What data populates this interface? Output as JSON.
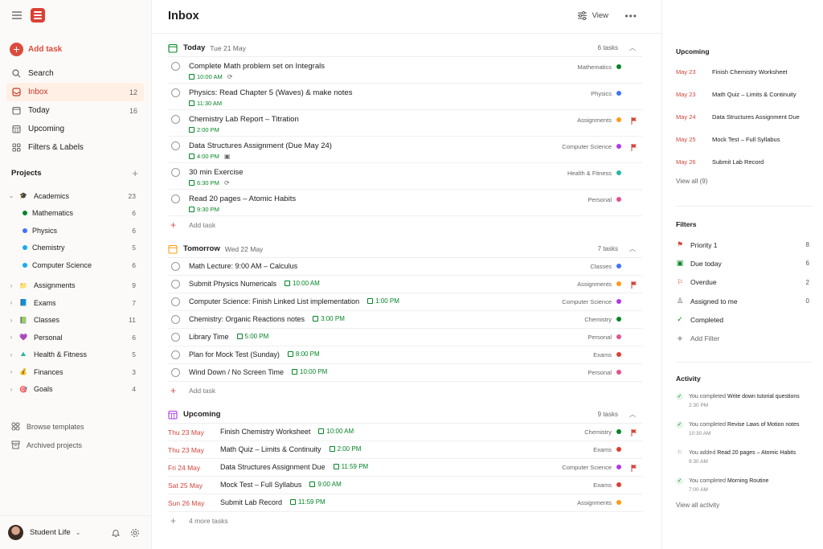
{
  "sidebar": {
    "add_task": "Add task",
    "nav": [
      {
        "label": "Search",
        "count": "",
        "icon": "search-icon"
      },
      {
        "label": "Inbox",
        "count": "12",
        "icon": "inbox-icon"
      },
      {
        "label": "Today",
        "count": "16",
        "icon": "calendar-icon"
      },
      {
        "label": "Upcoming",
        "count": "",
        "icon": "calendar-grid-icon"
      },
      {
        "label": "Filters & Labels",
        "count": "",
        "icon": "grid-icon"
      }
    ],
    "projects_title": "Projects",
    "projects": [
      {
        "label": "Academics",
        "count": "23",
        "icon": "🎓"
      },
      {
        "label": "Mathematics",
        "count": "6",
        "color": "#058527"
      },
      {
        "label": "Physics",
        "count": "6",
        "color": "#4073ff"
      },
      {
        "label": "Chemistry",
        "count": "5",
        "color": "#14aaf5"
      },
      {
        "label": "Computer Science",
        "count": "6",
        "color": "#14aaf5"
      },
      {
        "label": "Assignments",
        "count": "9",
        "icon": "📁"
      },
      {
        "label": "Exams",
        "count": "7",
        "icon": "📘"
      },
      {
        "label": "Classes",
        "count": "11",
        "icon": "📗"
      },
      {
        "label": "Personal",
        "count": "6",
        "icon": "💜"
      },
      {
        "label": "Health & Fitness",
        "count": "5",
        "icon": "⛰"
      },
      {
        "label": "Finances",
        "count": "3",
        "icon": "💰"
      },
      {
        "label": "Goals",
        "count": "4",
        "icon": "🎯"
      }
    ],
    "browse_templates": "Browse templates",
    "archived_projects": "Archived projects",
    "user": "Student Life"
  },
  "main": {
    "title": "Inbox",
    "view": "View",
    "today": {
      "title": "Today",
      "date": "Tue 21 May",
      "count": "6 tasks",
      "tasks": [
        {
          "name": "Complete Math problem set on Integrals",
          "time": "10:00 AM",
          "extra": "⟳",
          "project": "Mathematics",
          "color": "#058527",
          "flag": false
        },
        {
          "name": "Physics: Read Chapter 5 (Waves) & make notes",
          "time": "11:30 AM",
          "extra": "",
          "project": "Physics",
          "color": "#4073ff",
          "flag": false
        },
        {
          "name": "Chemistry Lab Report – Titration",
          "time": "2:00 PM",
          "extra": "",
          "project": "Assignments",
          "color": "#ff9a14",
          "flag": true
        },
        {
          "name": "Data Structures Assignment (Due May 24)",
          "time": "4:00 PM",
          "extra": "▣",
          "project": "Computer Science",
          "color": "#af38eb",
          "flag": true
        },
        {
          "name": "30 min Exercise",
          "time": "6:30 PM",
          "extra": "⟳",
          "project": "Health & Fitness",
          "color": "#25b8a5",
          "flag": false
        },
        {
          "name": "Read 20 pages – Atomic Habits",
          "time": "9:30 PM",
          "extra": "",
          "project": "Personal",
          "color": "#e05194",
          "flag": false
        }
      ],
      "add_task": "Add task"
    },
    "tomorrow": {
      "title": "Tomorrow",
      "date": "Wed 22 May",
      "count": "7 tasks",
      "tasks": [
        {
          "name": "Math Lecture: 9:00 AM – Calculus",
          "time": "",
          "project": "Classes",
          "color": "#4073ff",
          "flag": false
        },
        {
          "name": "Submit Physics Numericals",
          "time": "10:00 AM",
          "project": "Assignments",
          "color": "#ff9a14",
          "flag": true
        },
        {
          "name": "Computer Science: Finish Linked List implementation",
          "time": "1:00 PM",
          "project": "Computer Science",
          "color": "#af38eb",
          "flag": false
        },
        {
          "name": "Chemistry: Organic Reactions notes",
          "time": "3:00 PM",
          "project": "Chemistry",
          "color": "#058527",
          "flag": false
        },
        {
          "name": "Library Time",
          "time": "5:00 PM",
          "project": "Personal",
          "color": "#e05194",
          "flag": false
        },
        {
          "name": "Plan for Mock Test (Sunday)",
          "time": "8:00 PM",
          "project": "Exams",
          "color": "#db4035",
          "flag": false
        },
        {
          "name": "Wind Down / No Screen Time",
          "time": "10:00 PM",
          "project": "Personal",
          "color": "#e05194",
          "flag": false
        }
      ],
      "add_task": "Add task"
    },
    "upcoming": {
      "title": "Upcoming",
      "count": "9 tasks",
      "tasks": [
        {
          "day": "Thu 23 May",
          "name": "Finish Chemistry Worksheet",
          "time": "10:00 AM",
          "project": "Chemistry",
          "color": "#058527",
          "flag": true
        },
        {
          "day": "Thu 23 May",
          "name": "Math Quiz – Limits & Continuity",
          "time": "2:00 PM",
          "project": "Exams",
          "color": "#db4035",
          "flag": false
        },
        {
          "day": "Fri 24 May",
          "name": "Data Structures Assignment Due",
          "time": "11:59 PM",
          "project": "Computer Science",
          "color": "#af38eb",
          "flag": true
        },
        {
          "day": "Sat 25 May",
          "name": "Mock Test – Full Syllabus",
          "time": "9:00 AM",
          "project": "Exams",
          "color": "#db4035",
          "flag": false
        },
        {
          "day": "Sun 26 May",
          "name": "Submit Lab Record",
          "time": "11:59 PM",
          "project": "Assignments",
          "color": "#ff9a14",
          "flag": false
        }
      ],
      "more": "4 more tasks"
    }
  },
  "right": {
    "upcoming_title": "Upcoming",
    "upcoming": [
      {
        "date": "May 23",
        "name": "Finish Chemistry Worksheet"
      },
      {
        "date": "May 23",
        "name": "Math Quiz – Limits & Continuity"
      },
      {
        "date": "May 24",
        "name": "Data Structures Assignment Due"
      },
      {
        "date": "May 25",
        "name": "Mock Test – Full Syllabus"
      },
      {
        "date": "May 26",
        "name": "Submit Lab Record"
      }
    ],
    "view_all": "View all (9)",
    "filters_title": "Filters",
    "filters": [
      {
        "label": "Priority 1",
        "count": "8",
        "icon": "flag-icon"
      },
      {
        "label": "Due today",
        "count": "6",
        "icon": "calendar-icon"
      },
      {
        "label": "Overdue",
        "count": "2",
        "icon": "flag-icon"
      },
      {
        "label": "Assigned to me",
        "count": "0",
        "icon": "person-icon"
      },
      {
        "label": "Completed",
        "count": "",
        "icon": "check-circle-icon"
      }
    ],
    "add_filter": "Add Filter",
    "activity_title": "Activity",
    "activity": [
      {
        "who": "You completed",
        "what": "Write down tutorial questions",
        "time": "2:30 PM",
        "type": "complete"
      },
      {
        "who": "You completed",
        "what": "Revise Laws of Motion notes",
        "time": "10:30 AM",
        "type": "complete"
      },
      {
        "who": "You added",
        "what": "Read 20 pages – Atomic Habits",
        "time": "9:30 AM",
        "type": "add"
      },
      {
        "who": "You completed",
        "what": "Morning Routine",
        "time": "7:00 AM",
        "type": "complete"
      }
    ],
    "view_all_activity": "View all activity"
  }
}
